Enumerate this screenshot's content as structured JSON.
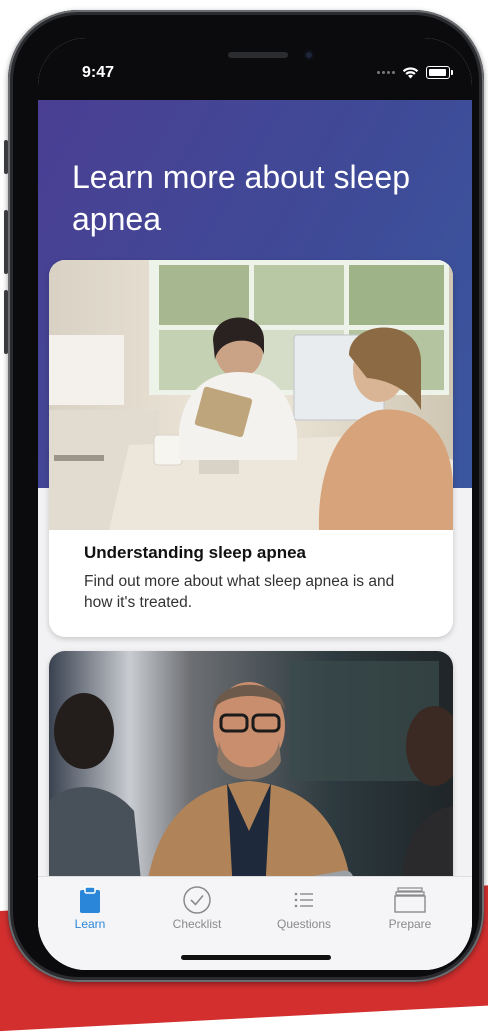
{
  "status_bar": {
    "time": "9:47"
  },
  "hero": {
    "title": "Learn more about sleep apnea"
  },
  "cards": [
    {
      "title": "Understanding sleep apnea",
      "description": "Find out more about what sleep apnea is and how it's treated.",
      "image_alt": "Doctor with tablet talking to a patient in a bright office"
    },
    {
      "title": "",
      "description": "",
      "image_alt": "Bearded man in a tan blazer smiling in a conversation"
    }
  ],
  "tabs": [
    {
      "label": "Learn",
      "icon": "clipboard-icon",
      "active": true
    },
    {
      "label": "Checklist",
      "icon": "check-circle-icon",
      "active": false
    },
    {
      "label": "Questions",
      "icon": "list-icon",
      "active": false
    },
    {
      "label": "Prepare",
      "icon": "folder-stack-icon",
      "active": false
    }
  ],
  "colors": {
    "accent": "#2a86d8",
    "hero_gradient_start": "#4a3f93",
    "hero_gradient_end": "#3a579f",
    "tab_inactive": "#8a8a8e"
  }
}
